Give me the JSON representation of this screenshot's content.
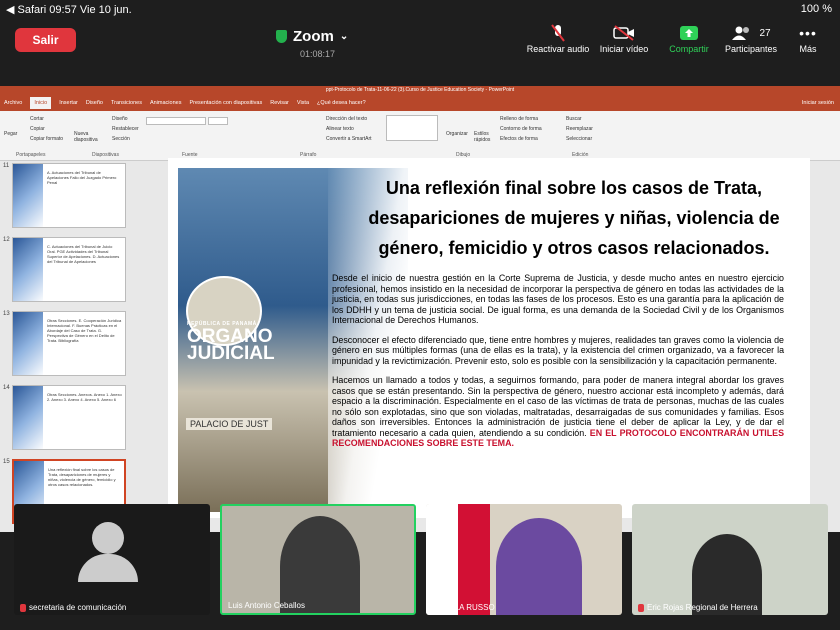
{
  "status": {
    "left": "◀ Safari  09:57   Vie 10 jun.",
    "right": "100 %"
  },
  "zoom": {
    "leave_label": "Salir",
    "title": "Zoom",
    "timer": "01:08:17",
    "buttons": [
      {
        "label": "Reactivar audio",
        "icon": "mic-muted-icon"
      },
      {
        "label": "Iniciar vídeo",
        "icon": "video-off-icon"
      },
      {
        "label": "Compartir",
        "icon": "share-screen-icon"
      },
      {
        "label": "Participantes",
        "icon": "participants-icon",
        "count": "27"
      },
      {
        "label": "Más",
        "icon": "more-icon"
      }
    ]
  },
  "ppt": {
    "window_title": "ppt-Protocolo de Trata-11-06-22 (3).Curso de Justice Education Society - PowerPoint",
    "menu": [
      "Archivo",
      "Inicio",
      "Insertar",
      "Diseño",
      "Transiciones",
      "Animaciones",
      "Presentación con diapositivas",
      "Revisar",
      "Vista",
      "¿Qué desea hacer?"
    ],
    "menu_right": "Iniciar sesión",
    "ribbon_items": [
      "Cortar",
      "Copiar",
      "Copiar formato",
      "Pegar",
      "Nueva diapositiva",
      "Diseño",
      "Restablecer",
      "Sección",
      "Dirección del texto",
      "Alinear texto",
      "Convertir a SmartArt",
      "Organizar",
      "Estilos rápidos",
      "Relleno de forma",
      "Contorno de forma",
      "Efectos de forma",
      "Buscar",
      "Reemplazar",
      "Seleccionar"
    ],
    "ribbon_groups": [
      "Portapapeles",
      "Diapositivas",
      "Fuente",
      "Párrafo",
      "Dibujo",
      "Edición"
    ],
    "thumbnails": [
      {
        "num": "11",
        "text": "A. Actuaciones del Tribunal de Apelaciones Fallo del Juzgado Primero Penal",
        "selected": false
      },
      {
        "num": "12",
        "text": "C. Actuaciones del Tribunal de Juicio Oral. PGE Actividades del Tribunal Superior de Apelaciones. D. Actuaciones del Tribunal de Apelaciones",
        "selected": false
      },
      {
        "num": "13",
        "text": "Otras Secciones. E. Cooperación Jurídica Internacional. F. Buenas Prácticas en el Abordaje del Caso de Trata. G. Perspectiva de Género en el Delito de Trata. Bibliografía",
        "selected": false
      },
      {
        "num": "14",
        "text": "Otras Secciones. Anexos. Anexo 1. Anexo 2. Anexo 3. Anexo 4. Anexo 5. Anexo 6",
        "selected": false
      },
      {
        "num": "15",
        "text": "Una reflexión final sobre los casos de Trata, desapariciones de mujeres y niñas, violencia de género, femicidio y otros casos relacionados.",
        "selected": true
      }
    ]
  },
  "slide": {
    "logo_small": "REPÚBLICA DE PANAMÁ",
    "logo_big": "ÓRGANO JUDICIAL",
    "building_sign": "PALACIO DE JUST",
    "title": "Una reflexión final sobre los casos de Trata, desapariciones de mujeres y niñas, violencia de género, femicidio y otros casos relacionados.",
    "p1": "Desde el inicio de nuestra gestión en la Corte Suprema de Justicia, y desde mucho antes en nuestro ejercicio profesional, hemos insistido en la necesidad de incorporar la perspectiva de género en todas las actividades de la justicia, en todas sus jurisdicciones, en todas las fases de los procesos. Esto es una garantía para la aplicación de los DDHH y un tema de justicia social. De igual forma, es una demanda de la Sociedad Civil y de los Organismos Internacional de Derechos Humanos.",
    "p2": "Desconocer el efecto diferenciado que, tiene entre hombres y mujeres, realidades tan graves como la violencia de género en sus múltiples formas (una de ellas es la trata), y la existencia del crimen organizado, va a favorecer la impunidad y la revictimización. Prevenir esto, solo es posible con la sensibilización y la capacitación permanente.",
    "p3": "Hacemos un llamado a todos y todas, a seguirnos formando, para poder de manera integral abordar los graves casos que se están presentando. Sin la perspectiva de género, nuestro accionar está incompleto y además, dará espacio a la discriminación. Especialmente en el caso de las víctimas de trata de personas, muchas de las cuales no sólo son explotadas, sino que son violadas, maltratadas, desarraigadas de sus comunidades y familias. Esos daños son irreversibles. Entonces la administración de justicia tiene el deber de aplicar la Ley, y de dar el tratamiento necesario a cada quien, atendiendo a su condición.",
    "p3_red": "EN EL PROTOCOLO ENCONTRARÁN UTILES RECOMENDACIONES SOBRE ESTE TEMA."
  },
  "participants": [
    {
      "name": "secretaria de comunicación",
      "muted": true,
      "video": false
    },
    {
      "name": "Luis Antonio Ceballos",
      "muted": false,
      "video": true,
      "active": true
    },
    {
      "name": "ANGELA RUSSO",
      "muted": false,
      "video": true
    },
    {
      "name": "Eric Rojas Regional de Herrera",
      "muted": true,
      "video": true
    }
  ]
}
